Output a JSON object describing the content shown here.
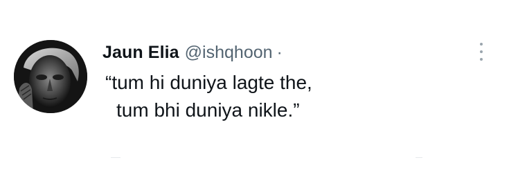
{
  "tweet": {
    "author": {
      "display_name": "Jaun Elia",
      "handle": "@ishqhoon",
      "separator": "·",
      "avatar_icon": "portrait-avatar"
    },
    "text_lines": [
      "“tum hi duniya lagte the,",
      "tum bhi duniya nikle.”"
    ],
    "menu_icon": "more-vertical-icon"
  },
  "colors": {
    "text_primary": "#0f1419",
    "text_secondary": "#536471",
    "background": "#ffffff"
  }
}
